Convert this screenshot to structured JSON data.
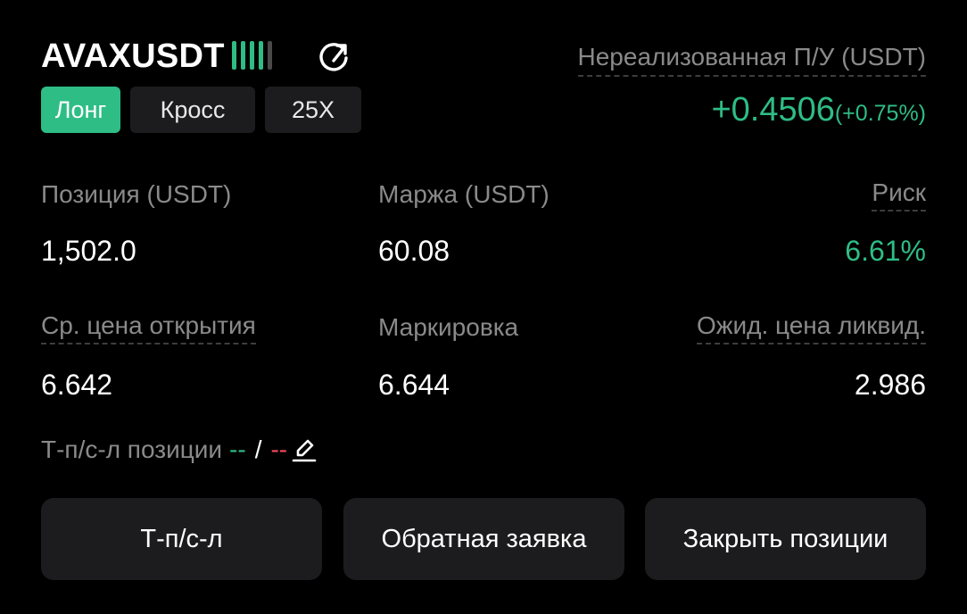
{
  "header": {
    "symbol": "AVAXUSDT",
    "signal_bars_active": 4,
    "signal_bars_total": 5,
    "share_icon": "share-icon"
  },
  "tags": {
    "side": "Лонг",
    "margin_mode": "Кросс",
    "leverage": "25X"
  },
  "pnl": {
    "label": "Нереализованная П/У (USDT)",
    "value": "+0.4506",
    "percent": "(+0.75%)"
  },
  "stats": {
    "position_label": "Позиция (USDT)",
    "position_value": "1,502.0",
    "margin_label": "Маржа (USDT)",
    "margin_value": "60.08",
    "risk_label": "Риск",
    "risk_value": "6.61%",
    "avg_open_label": "Ср. цена открытия",
    "avg_open_value": "6.642",
    "mark_label": "Маркировка",
    "mark_value": "6.644",
    "liq_label": "Ожид. цена ликвид.",
    "liq_value": "2.986"
  },
  "tpsl": {
    "label": "Т-п/с-л позиции",
    "tp": "--",
    "separator": "/",
    "sl": "--",
    "edit_icon": "edit-icon"
  },
  "buttons": {
    "tpsl": "Т-п/с-л",
    "reverse": "Обратная заявка",
    "close": "Закрыть позиции"
  },
  "colors": {
    "accent_green": "#2ebd85",
    "red": "#f6465d",
    "background": "#000000",
    "surface": "#1c1c1e"
  }
}
